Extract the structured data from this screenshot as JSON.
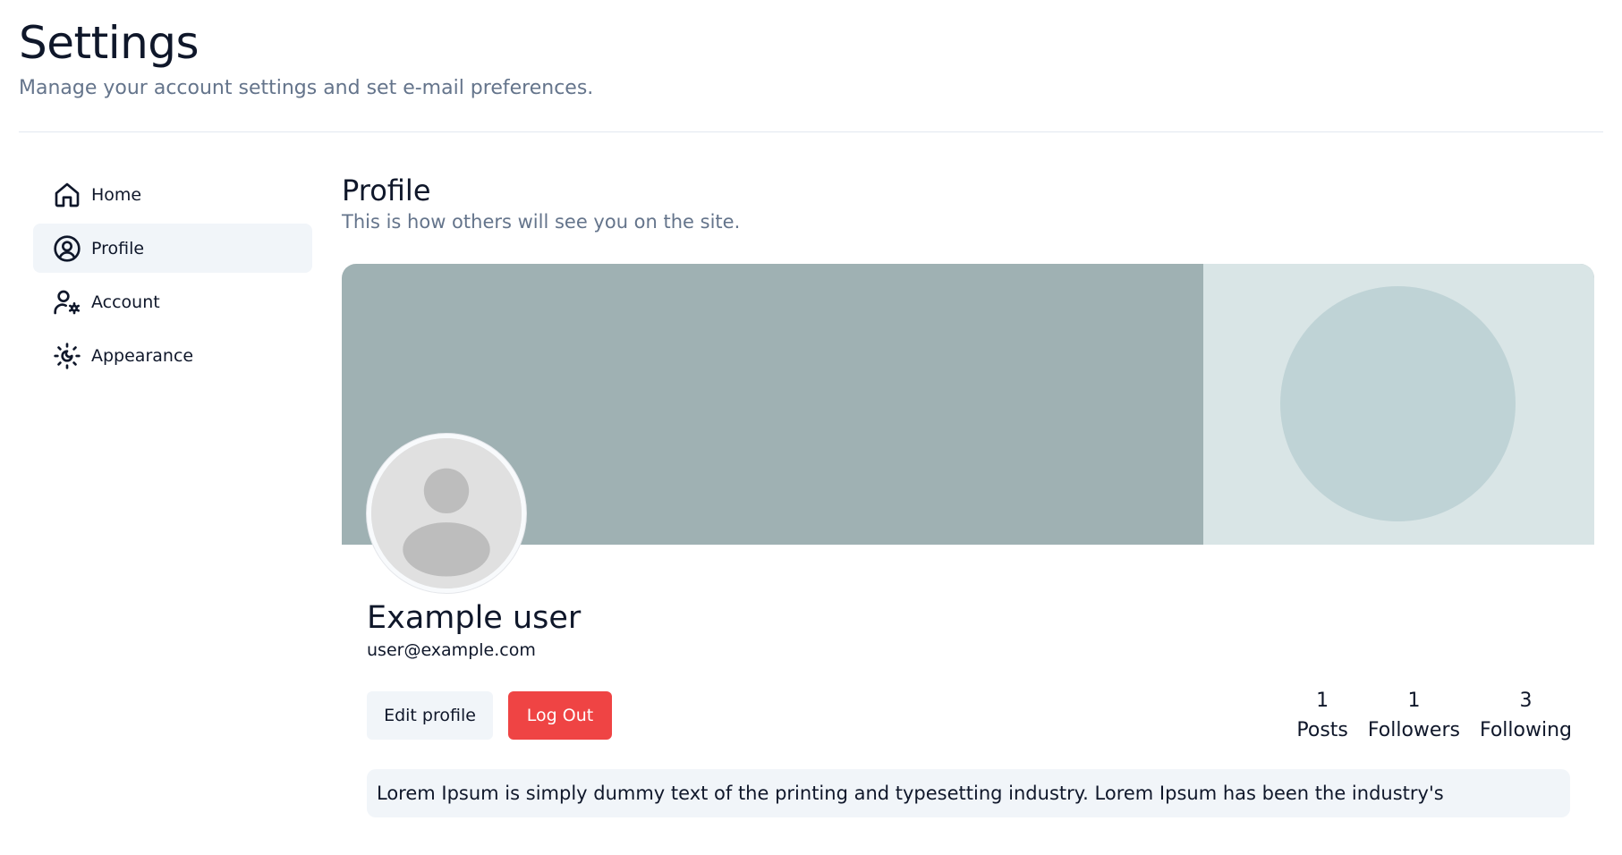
{
  "header": {
    "title": "Settings",
    "subtitle": "Manage your account settings and set e-mail preferences."
  },
  "sidebar": {
    "items": [
      {
        "label": "Home",
        "icon": "home-icon",
        "active": false
      },
      {
        "label": "Profile",
        "icon": "user-circle-icon",
        "active": true
      },
      {
        "label": "Account",
        "icon": "user-cog-icon",
        "active": false
      },
      {
        "label": "Appearance",
        "icon": "sun-moon-icon",
        "active": false
      }
    ]
  },
  "profile": {
    "title": "Profile",
    "subtitle": "This is how others will see you on the site.",
    "name": "Example user",
    "email": "user@example.com",
    "edit_label": "Edit profile",
    "logout_label": "Log Out",
    "stats": [
      {
        "value": "1",
        "label": "Posts"
      },
      {
        "value": "1",
        "label": "Followers"
      },
      {
        "value": "3",
        "label": "Following"
      }
    ],
    "bio": "Lorem Ipsum is simply dummy text of the printing and typesetting industry. Lorem Ipsum has been the industry's"
  },
  "colors": {
    "accent_danger": "#ef4444",
    "muted_text": "#64748b",
    "active_bg": "#f1f5f9",
    "banner_left": "#9fb1b3",
    "banner_right": "#d9e5e6"
  }
}
